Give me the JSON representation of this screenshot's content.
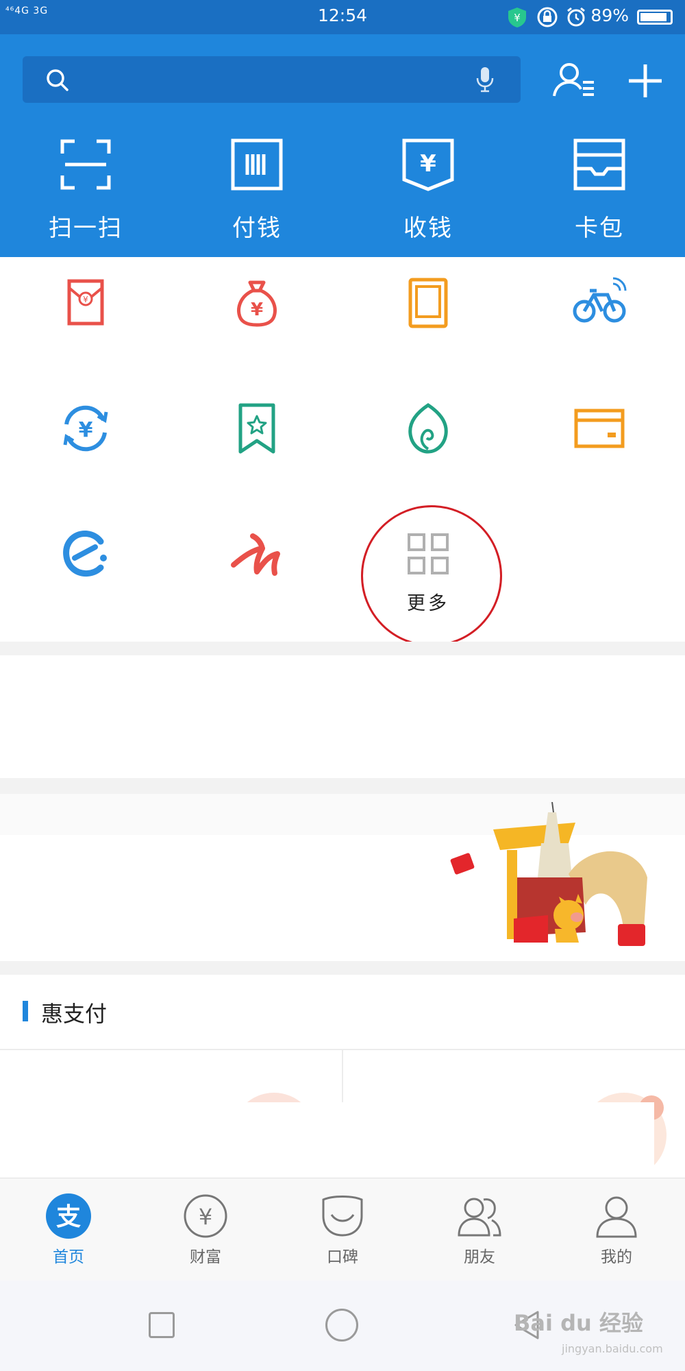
{
  "status_bar": {
    "network": "⁴⁶4G 3G",
    "time": "12:54",
    "battery": "89%"
  },
  "quick_actions": [
    {
      "label": "扫一扫",
      "icon": "scan-icon"
    },
    {
      "label": "付钱",
      "icon": "barcode-icon"
    },
    {
      "label": "收钱",
      "icon": "receive-money-icon"
    },
    {
      "label": "卡包",
      "icon": "card-wallet-icon"
    }
  ],
  "services": [
    {
      "icon": "red-envelope-icon",
      "color": "#e9514a"
    },
    {
      "icon": "money-bag-icon",
      "color": "#e9514a"
    },
    {
      "icon": "phone-recharge-icon",
      "color": "#f39c1f"
    },
    {
      "icon": "bike-icon",
      "color": "#2d8ee0"
    },
    {
      "icon": "transfer-icon",
      "color": "#2d8ee0"
    },
    {
      "icon": "favorite-bookmark-icon",
      "color": "#22a284"
    },
    {
      "icon": "ant-forest-icon",
      "color": "#22a284"
    },
    {
      "icon": "card-icon",
      "color": "#f39c1f"
    },
    {
      "icon": "eleme-icon",
      "color": "#2d8ee0"
    },
    {
      "icon": "fliggy-icon",
      "color": "#e9514a"
    }
  ],
  "more": {
    "label": "更多",
    "icon": "grid-icon"
  },
  "section": {
    "title": "惠支付"
  },
  "tabs": [
    {
      "label": "首页",
      "icon": "alipay-home-icon",
      "active": true
    },
    {
      "label": "财富",
      "icon": "wealth-icon",
      "active": false
    },
    {
      "label": "口碑",
      "icon": "koubei-icon",
      "active": false
    },
    {
      "label": "朋友",
      "icon": "friends-icon",
      "active": false
    },
    {
      "label": "我的",
      "icon": "profile-icon",
      "active": false
    }
  ],
  "watermark": {
    "text": "Bai du 经验",
    "sub": "jingyan.baidu.com"
  },
  "colors": {
    "header_blue": "#1f86dc",
    "status_blue": "#1a6fc2",
    "highlight_red": "#d31e25"
  }
}
